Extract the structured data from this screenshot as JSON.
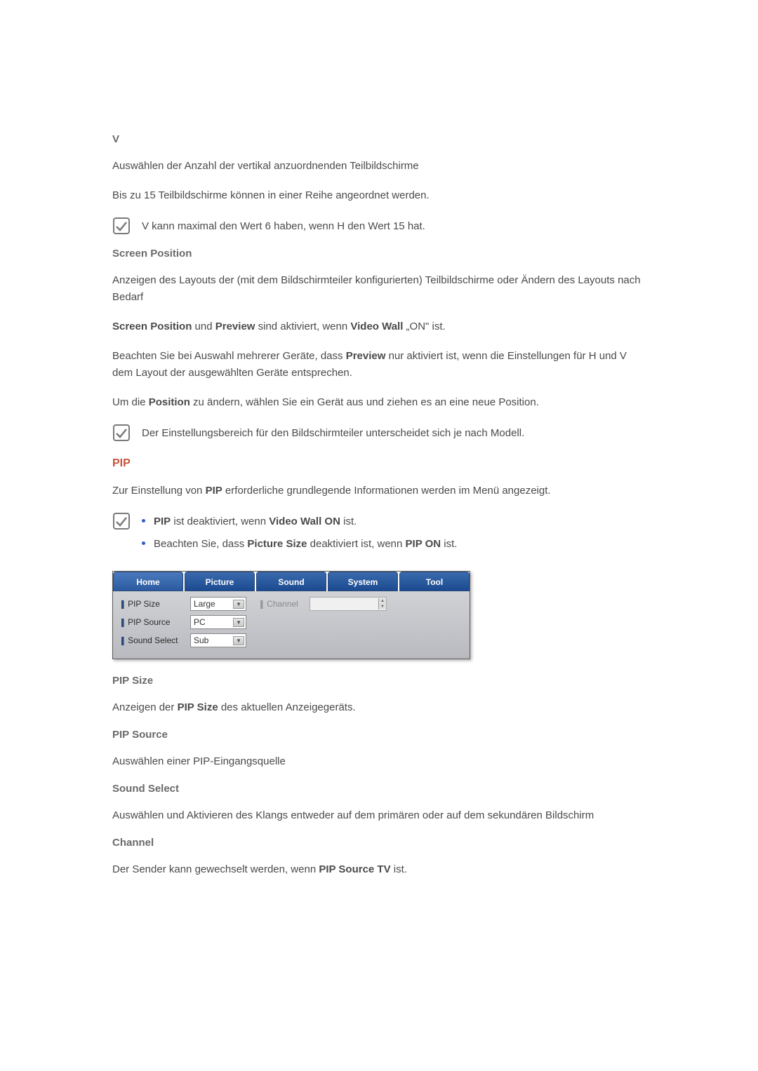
{
  "v_section": {
    "heading": "V",
    "p1": "Auswählen der Anzahl der vertikal anzuordnenden Teilbildschirme",
    "p2": "Bis zu 15 Teilbildschirme können in einer Reihe angeordnet werden.",
    "note": "V kann maximal den Wert 6 haben, wenn H den Wert 15 hat."
  },
  "screen_position": {
    "heading": "Screen Position",
    "p1": "Anzeigen des Layouts der (mit dem Bildschirmteiler konfigurierten) Teilbildschirme oder Ändern des Layouts nach Bedarf",
    "mixed1_pre": "",
    "mixed1_b1": "Screen Position",
    "mixed1_mid1": " und ",
    "mixed1_b2": "Preview",
    "mixed1_mid2": " sind aktiviert, wenn ",
    "mixed1_b3": "Video Wall",
    "mixed1_post": " „ON\" ist.",
    "mixed2_pre": "Beachten Sie bei Auswahl mehrerer Geräte, dass ",
    "mixed2_b1": "Preview",
    "mixed2_post": " nur aktiviert ist, wenn die Einstellungen für H und V dem Layout der ausgewählten Geräte entsprechen.",
    "mixed3_pre": "Um die ",
    "mixed3_b1": "Position",
    "mixed3_post": " zu ändern, wählen Sie ein Gerät aus und ziehen es an eine neue Position.",
    "note": "Der Einstellungsbereich für den Bildschirmteiler unterscheidet sich je nach Modell."
  },
  "pip": {
    "heading": "PIP",
    "p1_pre": "Zur Einstellung von ",
    "p1_b1": "PIP",
    "p1_post": " erforderliche grundlegende Informationen werden im Menü angezeigt.",
    "note1_b1": "PIP",
    "note1_mid": " ist deaktiviert, wenn ",
    "note1_b2": "Video Wall ON",
    "note1_post": " ist.",
    "note2_pre": "Beachten Sie, dass ",
    "note2_b1": "Picture Size",
    "note2_mid": " deaktiviert ist, wenn ",
    "note2_b2": "PIP ON",
    "note2_post": " ist."
  },
  "tabs": {
    "t0": "Home",
    "t1": "Picture",
    "t2": "Sound",
    "t3": "System",
    "t4": "Tool"
  },
  "panel": {
    "pip_size_label": "PIP Size",
    "pip_size_value": "Large",
    "pip_source_label": "PIP Source",
    "pip_source_value": "PC",
    "sound_select_label": "Sound Select",
    "sound_select_value": "Sub",
    "channel_label": "Channel"
  },
  "pip_size": {
    "heading": "PIP Size",
    "p_pre": "Anzeigen der ",
    "p_b1": "PIP Size",
    "p_post": " des aktuellen Anzeigegeräts."
  },
  "pip_source": {
    "heading": "PIP Source",
    "p1": "Auswählen einer PIP-Eingangsquelle"
  },
  "sound_select": {
    "heading": "Sound Select",
    "p1": "Auswählen und Aktivieren des Klangs entweder auf dem primären oder auf dem sekundären Bildschirm"
  },
  "channel": {
    "heading": "Channel",
    "p_pre": "Der Sender kann gewechselt werden, wenn ",
    "p_b1": "PIP Source TV",
    "p_post": " ist."
  }
}
